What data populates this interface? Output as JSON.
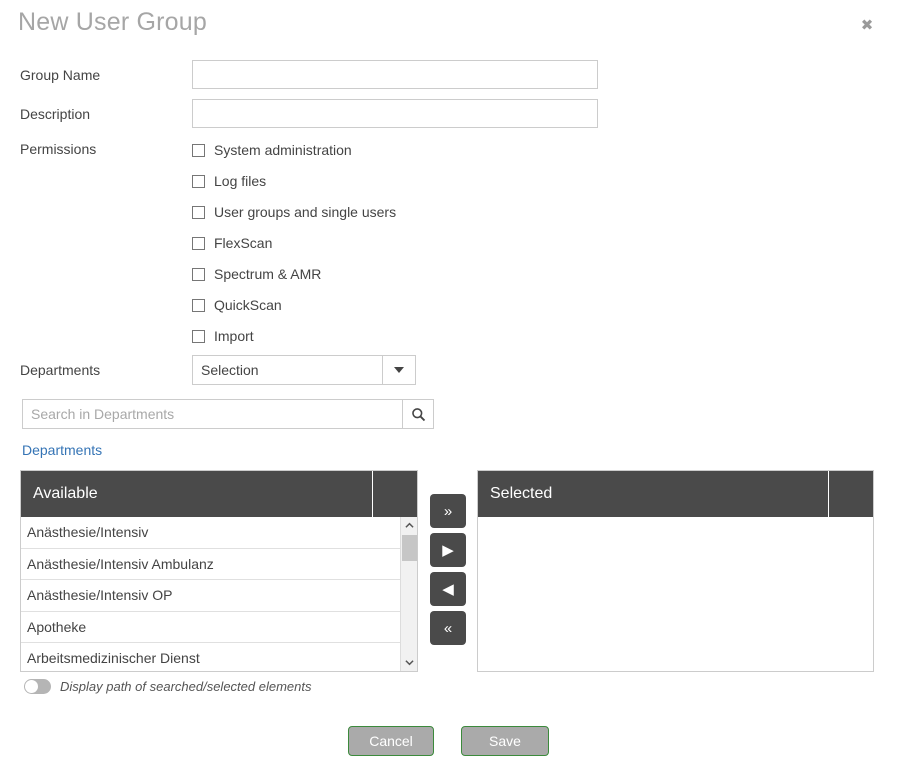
{
  "dialog": {
    "title": "New User Group",
    "close_icon": "close-icon"
  },
  "form": {
    "group_name_label": "Group Name",
    "group_name_value": "",
    "group_name_placeholder": "",
    "description_label": "Description",
    "description_value": "",
    "description_placeholder": "",
    "permissions_label": "Permissions",
    "permissions": [
      {
        "label": "System administration",
        "checked": false
      },
      {
        "label": "Log files",
        "checked": false
      },
      {
        "label": "User groups and single users",
        "checked": false
      },
      {
        "label": "FlexScan",
        "checked": false
      },
      {
        "label": "Spectrum & AMR",
        "checked": false
      },
      {
        "label": "QuickScan",
        "checked": false
      },
      {
        "label": "Import",
        "checked": false
      }
    ],
    "departments_label": "Departments",
    "departments_select_value": "Selection",
    "departments_caret_icon": "chevron-down-icon"
  },
  "search": {
    "placeholder": "Search in Departments",
    "value": "",
    "icon": "search-icon"
  },
  "breadcrumb": {
    "departments_link": "Departments"
  },
  "dual_list": {
    "available": {
      "header": "Available",
      "items": [
        "Anästhesie/Intensiv",
        "Anästhesie/Intensiv Ambulanz",
        "Anästhesie/Intensiv OP",
        "Apotheke",
        "Arbeitsmedizinischer Dienst"
      ]
    },
    "selected": {
      "header": "Selected",
      "items": []
    },
    "transfer_buttons": [
      {
        "glyph": "»",
        "name": "move-all-right-button"
      },
      {
        "glyph": "▶",
        "name": "move-right-button"
      },
      {
        "glyph": "◀",
        "name": "move-left-button"
      },
      {
        "glyph": "«",
        "name": "move-all-left-button"
      }
    ],
    "scrollbar": {
      "up_arrow": "⌃",
      "down_arrow": "⌄"
    }
  },
  "toggle": {
    "label": "Display path of searched/selected elements",
    "state": "off"
  },
  "footer": {
    "cancel_label": "Cancel",
    "save_label": "Save"
  },
  "colors": {
    "header_dark": "#4a4a4a",
    "link_blue": "#3574b5",
    "button_border_green": "#3c8a3c",
    "button_gray": "#aaaaaa",
    "title_gray": "#a6a6a6"
  }
}
